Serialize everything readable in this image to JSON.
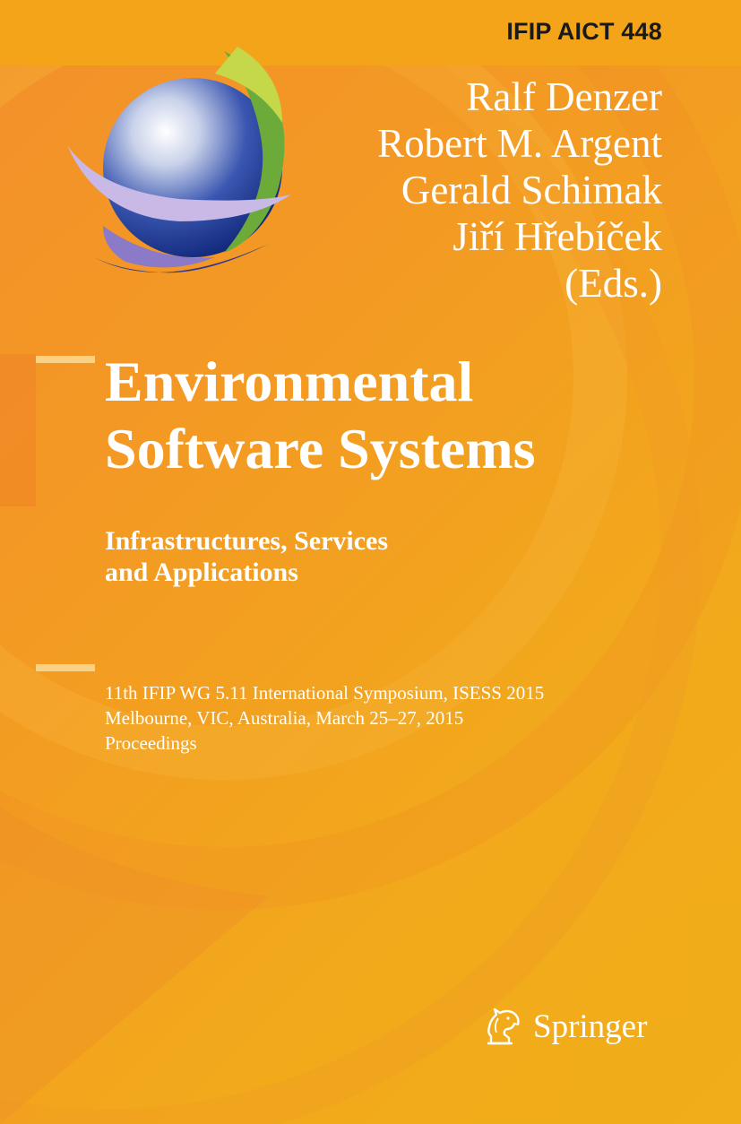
{
  "series": {
    "label": "IFIP AICT 448"
  },
  "editors": {
    "names": [
      "Ralf Denzer",
      "Robert M. Argent",
      "Gerald Schimak",
      "Jiří Hřebíček"
    ],
    "suffix": "(Eds.)"
  },
  "book": {
    "title_line1": "Environmental",
    "title_line2": "Software Systems",
    "subtitle_line1": "Infrastructures, Services",
    "subtitle_line2": "and Applications"
  },
  "event": {
    "line1": "11th IFIP WG 5.11 International Symposium, ISESS 2015",
    "line2": "Melbourne, VIC, Australia, March 25–27, 2015",
    "line3": "Proceedings"
  },
  "publisher": {
    "name": "Springer",
    "icon": "springer-horse-icon"
  },
  "colors": {
    "background": "#f4a71a",
    "accent_line": "#fbd285",
    "text": "#ffffff",
    "series_text": "#1a1a1a"
  }
}
